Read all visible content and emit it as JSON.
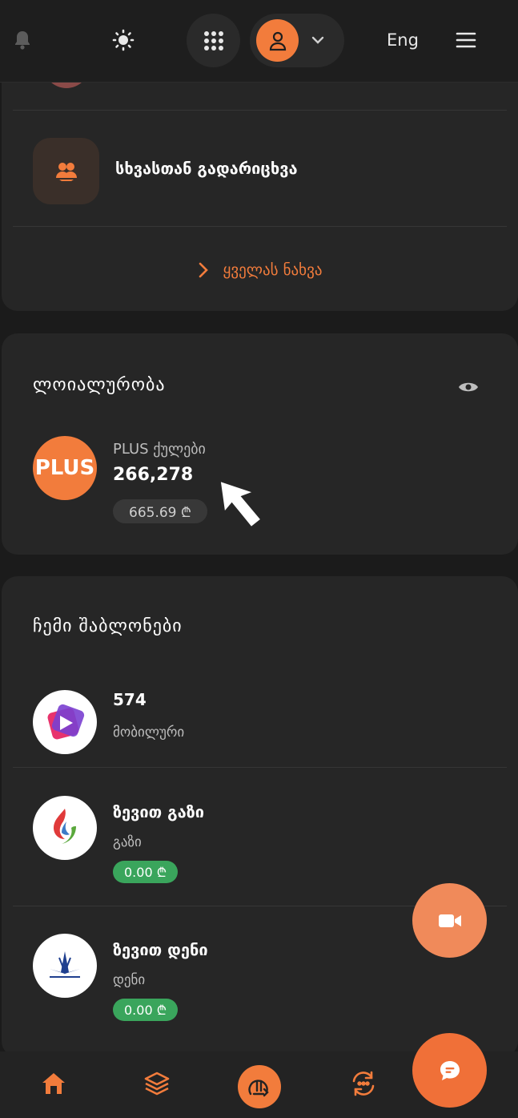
{
  "header": {
    "language": "Eng",
    "icons": [
      "bell-icon",
      "sun-icon",
      "apps-grid-icon",
      "user-icon",
      "chevron-down-icon",
      "menu-icon"
    ]
  },
  "transfers": {
    "split_label": "სხვასთან გადარიცხვა",
    "see_all": "ყველას ნახვა"
  },
  "loyalty": {
    "title": "ლოიალურობა",
    "logo_text": "PLUS",
    "points_label": "PLUS ქულები",
    "points_value": "266,278",
    "money_value": "665.69 ₾"
  },
  "templates": {
    "title": "ჩემი შაბლონები",
    "items": [
      {
        "name": "574",
        "subtitle": "მობილური",
        "amount": ""
      },
      {
        "name": "ზევით გაზი",
        "subtitle": "გაზი",
        "amount": "0.00 ₾"
      },
      {
        "name": "ზევით დენი",
        "subtitle": "დენი",
        "amount": "0.00 ₾"
      }
    ]
  },
  "colors": {
    "accent": "#f27c3c",
    "background": "#1b1b1b",
    "card": "#262626",
    "success": "#3aa55c"
  },
  "bottom_nav": [
    "home-icon",
    "layers-icon",
    "payments-icon",
    "transfer-icon"
  ]
}
